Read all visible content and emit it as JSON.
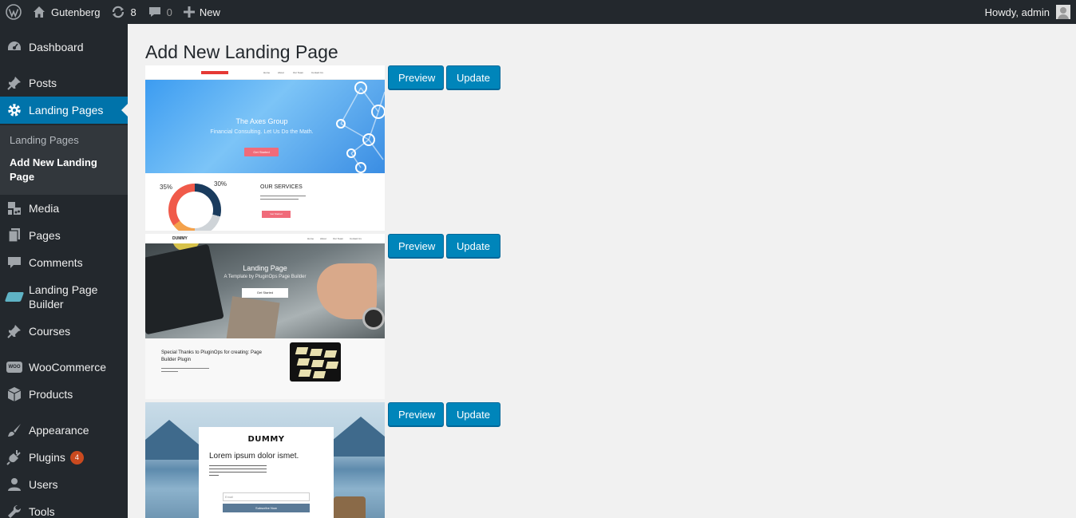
{
  "admin_bar": {
    "site_name": "Gutenberg",
    "updates_count": "8",
    "comments_count": "0",
    "new_label": "New",
    "greeting": "Howdy, admin"
  },
  "sidebar": {
    "items": [
      {
        "label": "Dashboard",
        "icon": "dashboard-icon"
      },
      {
        "label": "Posts",
        "icon": "pin-icon"
      },
      {
        "label": "Landing Pages",
        "icon": "gear-icon"
      },
      {
        "label": "Media",
        "icon": "media-icon"
      },
      {
        "label": "Pages",
        "icon": "pages-icon"
      },
      {
        "label": "Comments",
        "icon": "comment-icon"
      },
      {
        "label": "Landing Page Builder",
        "icon": "builder-icon"
      },
      {
        "label": "Courses",
        "icon": "pin-icon"
      },
      {
        "label": "WooCommerce",
        "icon": "woo-icon"
      },
      {
        "label": "Products",
        "icon": "box-icon"
      },
      {
        "label": "Appearance",
        "icon": "brush-icon"
      },
      {
        "label": "Plugins",
        "icon": "plug-icon",
        "badge": "4"
      },
      {
        "label": "Users",
        "icon": "user-icon"
      },
      {
        "label": "Tools",
        "icon": "wrench-icon"
      }
    ],
    "submenu": [
      {
        "label": "Landing Pages"
      },
      {
        "label": "Add New Landing Page"
      }
    ]
  },
  "main": {
    "title": "Add New Landing Page",
    "templates": [
      {
        "preview_label": "Preview",
        "update_label": "Update",
        "thumb": {
          "hero_title": "The Axes Group",
          "hero_subtitle": "Financial Consulting. Let Us Do the Math.",
          "cta": "Get Started",
          "pct_left": "35%",
          "pct_right": "30%",
          "services_title": "OUR SERVICES",
          "services_cta": "Get Started",
          "nav": [
            "Home",
            "About",
            "Our Team",
            "Contact Us"
          ]
        }
      },
      {
        "preview_label": "Preview",
        "update_label": "Update",
        "thumb": {
          "logo": "DUMMY",
          "hero_title": "Landing Page",
          "hero_subtitle": "A Template by PluginOps Page Builder",
          "cta": "Get Started",
          "thanks": "Special Thanks to PluginOps for creating: Page Builder Plugin",
          "nav": [
            "Home",
            "About",
            "Our Team",
            "Contact Us"
          ]
        }
      },
      {
        "preview_label": "Preview",
        "update_label": "Update",
        "thumb": {
          "logo": "DUMMY",
          "heading": "Lorem ipsum dolor ismet.",
          "email_placeholder": "Email",
          "subscribe": "Subscribe Now"
        }
      }
    ]
  },
  "colors": {
    "admin_bg": "#23282d",
    "accent": "#0073aa",
    "button": "#0085ba",
    "badge": "#ca4a1f"
  }
}
